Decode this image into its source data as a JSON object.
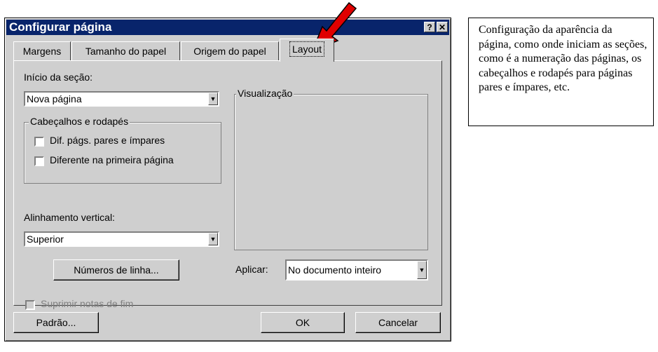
{
  "dialog": {
    "title": "Configurar página",
    "help_button": "?",
    "close_button": "✕",
    "tabs": [
      {
        "label": "Margens"
      },
      {
        "label": "Tamanho do papel"
      },
      {
        "label": "Origem do papel"
      },
      {
        "label": "Layout"
      }
    ],
    "section_start_label": "Início da seção:",
    "section_start_value": "Nova página",
    "headers_group_title": "Cabeçalhos e rodapés",
    "odd_even_label": "Dif. págs. pares e ímpares",
    "first_page_label": "Diferente na primeira página",
    "vertical_align_label": "Alinhamento vertical:",
    "vertical_align_value": "Superior",
    "line_numbers_button": "Números de linha...",
    "suppress_endnotes_label": "Suprimir notas de fim",
    "preview_title": "Visualização",
    "apply_label": "Aplicar:",
    "apply_value": "No documento inteiro",
    "default_button": "Padrão...",
    "ok_button": "OK",
    "cancel_button": "Cancelar"
  },
  "callout": {
    "text": "Configuração da aparência da página, como onde iniciam as seções, como é a numeração das páginas, os cabeçalhos e rodapés para páginas pares e ímpares, etc."
  },
  "colors": {
    "title_bar": "#08246b",
    "dialog_bg": "#cfcfcf",
    "arrow": "#e00000"
  },
  "icons": [
    "help-icon",
    "close-icon",
    "dropdown-arrow-icon",
    "red-arrow-icon"
  ]
}
